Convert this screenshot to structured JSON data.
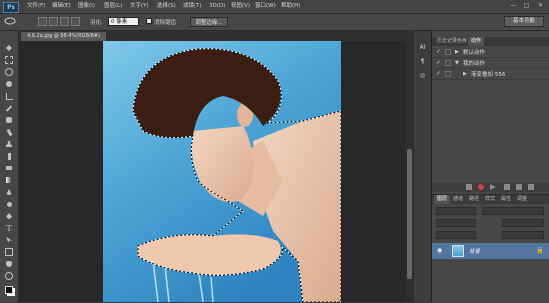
{
  "app": {
    "logo": "Ps"
  },
  "menu": {
    "items": [
      "文件(F)",
      "编辑(E)",
      "图像(I)",
      "图层(L)",
      "文字(Y)",
      "选择(S)",
      "滤镜(T)",
      "3D(D)",
      "视图(V)",
      "窗口(W)",
      "帮助(H)"
    ],
    "window_buttons": [
      "—",
      "□",
      "✕"
    ]
  },
  "options": {
    "feather_label": "羽化:",
    "feather_value": "0 像素",
    "antialias_label": "消除锯齿",
    "refine_button": "调整边缘...",
    "workspace_button": "基本功能"
  },
  "document": {
    "tab_title": "4.6.2a.jpg @ 98.4%(RGB/8#)"
  },
  "right_strip": {
    "icons": [
      "AI",
      "¶",
      "◎"
    ]
  },
  "actions_panel": {
    "tabs": [
      "历史记录",
      "色板",
      "动作"
    ],
    "rows": [
      {
        "label": "默认动作",
        "level": 0
      },
      {
        "label": "我的动作",
        "level": 0
      },
      {
        "label": "渐变叠加 556",
        "level": 1
      }
    ]
  },
  "layers_panel": {
    "tabs": [
      "图层",
      "通道",
      "路径",
      "样式",
      "属性",
      "调整"
    ],
    "layer_name": "背景"
  },
  "colors": {
    "accent": "#5574a0",
    "selection": "#ffffff"
  }
}
